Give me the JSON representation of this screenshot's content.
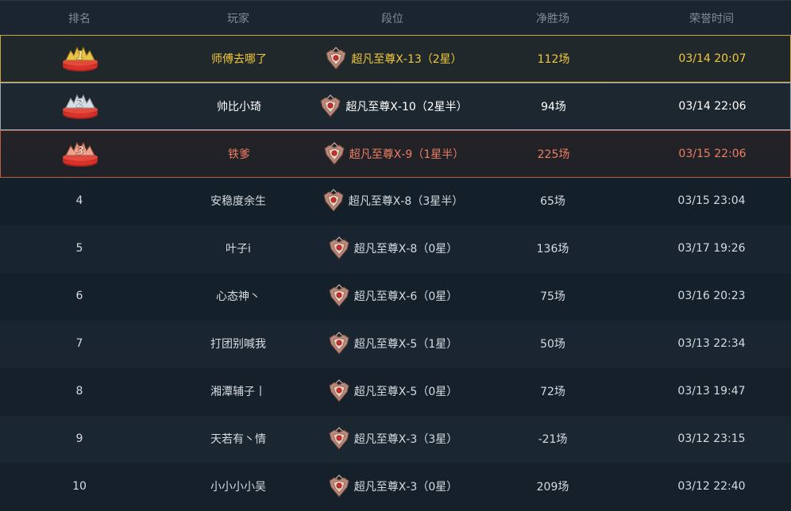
{
  "header": {
    "rank": "排名",
    "player": "玩家",
    "tier": "段位",
    "net_wins": "净胜场",
    "honor_time": "荣誉时间"
  },
  "rows": [
    {
      "rank": "1",
      "medal": true,
      "player": "师傅去哪了",
      "tier": "超凡至尊Ⅹ-13（2星）",
      "wins": "112场",
      "time": "03/14 20:07"
    },
    {
      "rank": "2",
      "medal": true,
      "player": "帅比小琦",
      "tier": "超凡至尊Ⅹ-10（2星半）",
      "wins": "94场",
      "time": "03/14 22:06"
    },
    {
      "rank": "3",
      "medal": true,
      "player": "铁爹",
      "tier": "超凡至尊Ⅹ-9（1星半）",
      "wins": "225场",
      "time": "03/15 22:06"
    },
    {
      "rank": "4",
      "medal": false,
      "player": "安稳度余生",
      "tier": "超凡至尊Ⅹ-8（3星半）",
      "wins": "65场",
      "time": "03/15 23:04"
    },
    {
      "rank": "5",
      "medal": false,
      "player": "叶子i",
      "tier": "超凡至尊Ⅹ-8（0星）",
      "wins": "136场",
      "time": "03/17 19:26"
    },
    {
      "rank": "6",
      "medal": false,
      "player": "心态神丶",
      "tier": "超凡至尊Ⅹ-6（0星）",
      "wins": "75场",
      "time": "03/16 20:23"
    },
    {
      "rank": "7",
      "medal": false,
      "player": "打团别喊我",
      "tier": "超凡至尊Ⅹ-5（1星）",
      "wins": "50场",
      "time": "03/13 22:34"
    },
    {
      "rank": "8",
      "medal": false,
      "player": "湘潭辅子丨",
      "tier": "超凡至尊Ⅹ-5（0星）",
      "wins": "72场",
      "time": "03/13 19:47"
    },
    {
      "rank": "9",
      "medal": false,
      "player": "天若有丶情",
      "tier": "超凡至尊Ⅹ-3（3星）",
      "wins": "-21场",
      "time": "03/12 23:15"
    },
    {
      "rank": "10",
      "medal": false,
      "player": "小小小小吴",
      "tier": "超凡至尊Ⅹ-3（0星）",
      "wins": "209场",
      "time": "03/12 22:40"
    }
  ],
  "colors": {
    "gold": "#f2c93a",
    "silver": "#ffffff",
    "bronze": "#ef7d63",
    "normal": "#d6dbe0",
    "header_text": "#7f8b97"
  },
  "icons": {
    "medal": "rank-medal-icon",
    "tier": "tier-emblem-icon"
  }
}
